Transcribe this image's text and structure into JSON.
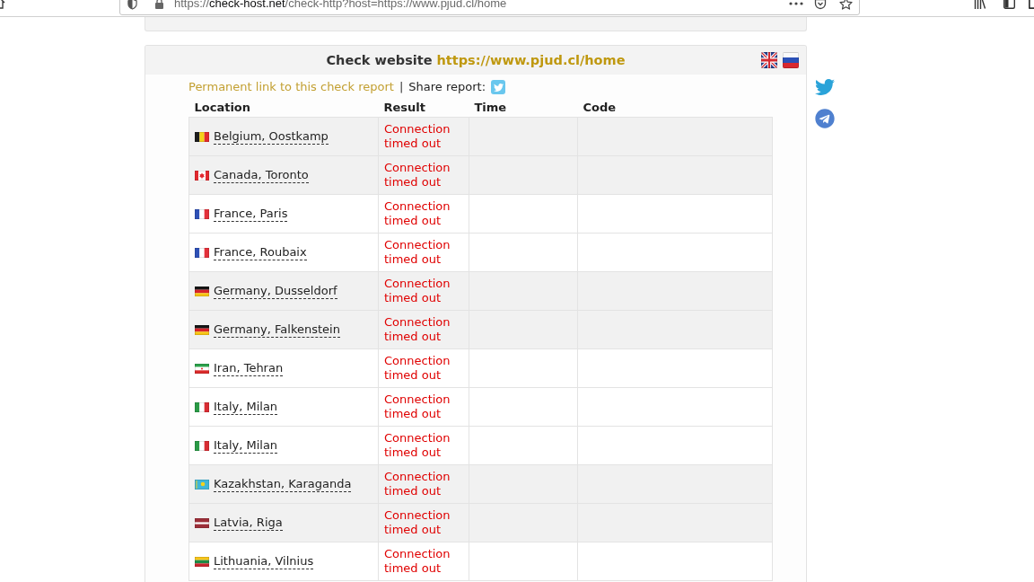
{
  "browser": {
    "address": {
      "scheme": "https://",
      "domain": "check-host.net",
      "path": "/check-http?host=https://www.pjud.cl/home"
    }
  },
  "report": {
    "title": "Check website",
    "target": "https://www.pjud.cl/home",
    "languages": [
      {
        "kind": "gb"
      },
      {
        "kind": "ru"
      }
    ],
    "permalink": "Permanent link to this check report",
    "separator": "|",
    "share_label": "Share report:"
  },
  "table": {
    "columns": [
      "Location",
      "Result",
      "Time",
      "Code"
    ],
    "rows": [
      {
        "kind": "be",
        "location": "Belgium, Oostkamp",
        "result": "Connection timed out",
        "shaded": true
      },
      {
        "kind": "ca",
        "location": "Canada, Toronto",
        "result": "Connection timed out",
        "shaded": true
      },
      {
        "kind": "fr",
        "location": "France, Paris",
        "result": "Connection timed out",
        "shaded": false
      },
      {
        "kind": "fr",
        "location": "France, Roubaix",
        "result": "Connection timed out",
        "shaded": false
      },
      {
        "kind": "de",
        "location": "Germany, Dusseldorf",
        "result": "Connection timed out",
        "shaded": true
      },
      {
        "kind": "de",
        "location": "Germany, Falkenstein",
        "result": "Connection timed out",
        "shaded": true
      },
      {
        "kind": "ir",
        "location": "Iran, Tehran",
        "result": "Connection timed out",
        "shaded": false
      },
      {
        "kind": "it",
        "location": "Italy, Milan",
        "result": "Connection timed out",
        "shaded": false
      },
      {
        "kind": "it",
        "location": "Italy, Milan",
        "result": "Connection timed out",
        "shaded": false
      },
      {
        "kind": "kz",
        "location": "Kazakhstan, Karaganda",
        "result": "Connection timed out",
        "shaded": true
      },
      {
        "kind": "lv",
        "location": "Latvia, Riga",
        "result": "Connection timed out",
        "shaded": true
      },
      {
        "kind": "lt",
        "location": "Lithuania, Vilnius",
        "result": "Connection timed out",
        "shaded": false
      }
    ]
  }
}
